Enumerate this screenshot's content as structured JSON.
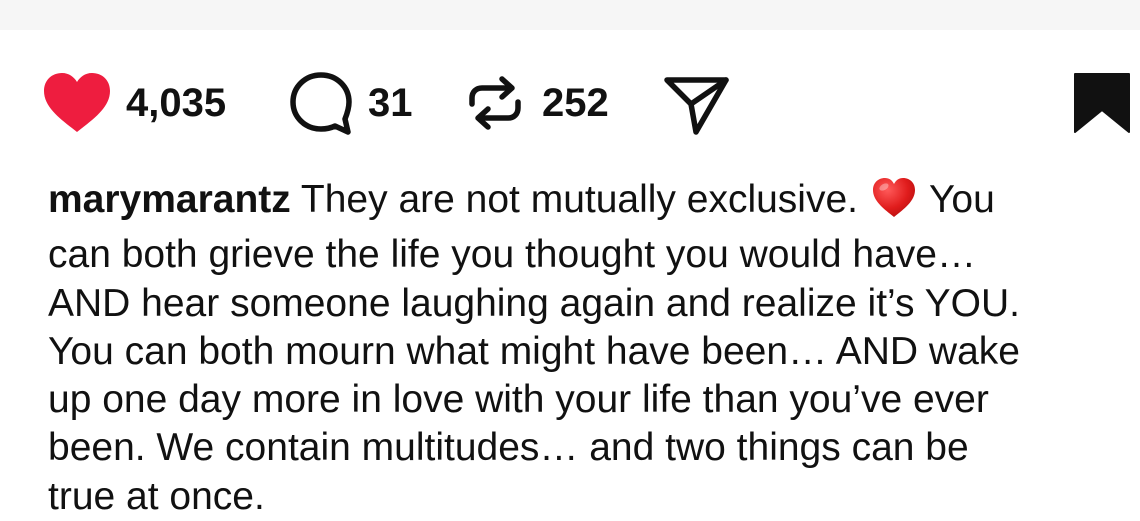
{
  "post": {
    "actions": {
      "likes": "4,035",
      "comments": "31",
      "reposts": "252"
    },
    "caption": {
      "username": "marymarantz",
      "line1_text": " They are not mutually exclusive. ",
      "line1_after_emoji": " You",
      "lines": [
        "can both grieve the life you thought you would have…",
        "AND hear someone laughing again and realize it’s YOU.",
        "You can both mourn what might have been… AND wake",
        "up one day more in love with your life than you’ve ever",
        "been. We contain multitudes… and two things can be",
        "true at once."
      ],
      "emoji": "red-heart-emoji"
    }
  },
  "colors": {
    "like_red": "#ee1d3f",
    "text": "#111111",
    "top_strip": "#f6f6f6"
  },
  "icons": [
    "heart-icon",
    "comment-icon",
    "repost-icon",
    "share-icon",
    "bookmark-icon"
  ]
}
